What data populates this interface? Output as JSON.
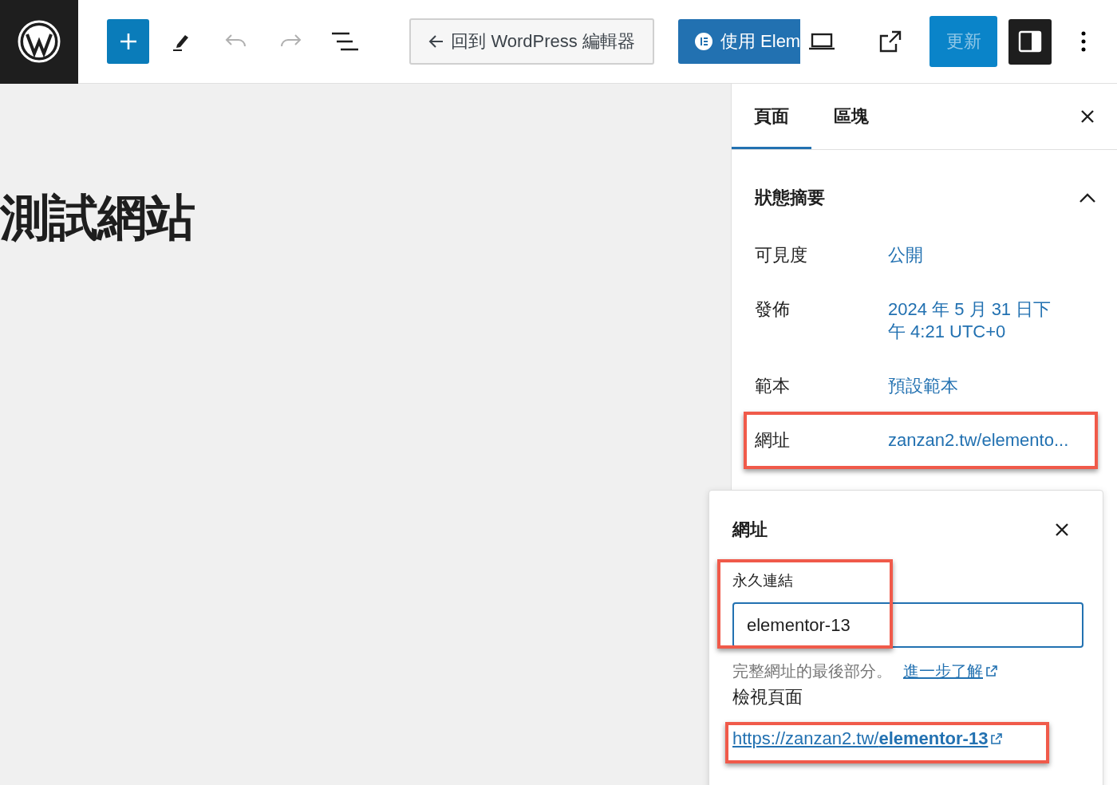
{
  "toolbar": {
    "back_button": "回到 WordPress 編輯器",
    "elementor_button": "使用 Elem",
    "update_button": {
      "label": "更新",
      "disabled": true
    },
    "settings_toggle": {
      "pressed": true
    }
  },
  "canvas": {
    "title": "測試網站"
  },
  "sidebar": {
    "tabs": [
      {
        "label": "頁面",
        "selected": true
      },
      {
        "label": "區塊",
        "selected": false
      }
    ],
    "panel": {
      "title": "狀態摘要",
      "expanded": true,
      "rows": [
        {
          "label": "可見度",
          "value": "公開",
          "highlighted": false
        },
        {
          "label": "發佈",
          "value": "2024 年 5 月 31 日下午 4:21 UTC+0",
          "highlighted": false
        },
        {
          "label": "範本",
          "value": "預設範本",
          "highlighted": false
        },
        {
          "label": "網址",
          "value": "zanzan2.tw/elemento...",
          "highlighted": true
        }
      ]
    }
  },
  "popover": {
    "title": "網址",
    "permalink": {
      "label": "永久連結",
      "value": "elementor-13",
      "highlighted": true
    },
    "help": "完整網址的最後部分。",
    "learn_more": "進一步了解",
    "view_heading": "檢視頁面",
    "view_link": {
      "text": "https://zanzan2.tw/**elementor-13**",
      "highlighted": true
    }
  }
}
